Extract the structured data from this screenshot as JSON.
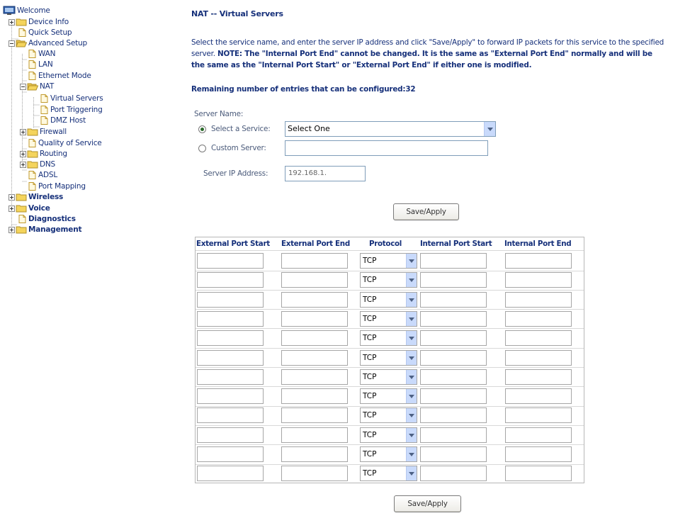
{
  "sidebar": {
    "items": [
      {
        "label": "Welcome",
        "icon": "monitor-icon",
        "bold": false
      },
      {
        "label": "Device Info",
        "icon": "folder-icon",
        "bold": false
      },
      {
        "label": "Quick Setup",
        "icon": "document-icon",
        "bold": false
      },
      {
        "label": "Advanced Setup",
        "icon": "folder-open-icon",
        "bold": false
      },
      {
        "label": "WAN",
        "icon": "document-icon",
        "bold": false
      },
      {
        "label": "LAN",
        "icon": "document-icon",
        "bold": false
      },
      {
        "label": "Ethernet Mode",
        "icon": "document-icon",
        "bold": false
      },
      {
        "label": "NAT",
        "icon": "folder-open-icon",
        "bold": false
      },
      {
        "label": "Virtual Servers",
        "icon": "document-icon",
        "bold": false
      },
      {
        "label": "Port Triggering",
        "icon": "document-icon",
        "bold": false
      },
      {
        "label": "DMZ Host",
        "icon": "document-icon",
        "bold": false
      },
      {
        "label": "Firewall",
        "icon": "folder-icon",
        "bold": false
      },
      {
        "label": "Quality of Service",
        "icon": "document-icon",
        "bold": false
      },
      {
        "label": "Routing",
        "icon": "folder-icon",
        "bold": false
      },
      {
        "label": "DNS",
        "icon": "folder-icon",
        "bold": false
      },
      {
        "label": "ADSL",
        "icon": "document-icon",
        "bold": false
      },
      {
        "label": "Port Mapping",
        "icon": "document-icon",
        "bold": false
      },
      {
        "label": "Wireless",
        "icon": "folder-icon",
        "bold": true
      },
      {
        "label": "Voice",
        "icon": "folder-icon",
        "bold": true
      },
      {
        "label": "Diagnostics",
        "icon": "document-icon",
        "bold": true
      },
      {
        "label": "Management",
        "icon": "folder-icon",
        "bold": true
      }
    ]
  },
  "main": {
    "title": "NAT -- Virtual Servers",
    "desc_plain": "Select the service name, and enter the server IP address and click \"Save/Apply\" to forward IP packets for this service to the specified server. ",
    "desc_bold": "NOTE: The \"Internal Port End\" cannot be changed. It is the same as \"External Port End\" normally and will be the same as the \"Internal Port Start\" or \"External Port End\" if either one is modified.",
    "remaining": "Remaining number of entries that can be configured:32",
    "server_name_label": "Server Name:",
    "select_service_label": "Select a Service:",
    "select_service_value": "Select One",
    "custom_server_label": "Custom Server:",
    "custom_server_value": "",
    "server_ip_label": "Server IP Address:",
    "server_ip_value": "192.168.1.",
    "save_apply_label": "Save/Apply",
    "save_apply_bottom_label": "Save/Apply"
  },
  "table": {
    "headers": [
      "External Port Start",
      "External Port End",
      "Protocol",
      "Internal Port Start",
      "Internal Port End"
    ],
    "rows": [
      {
        "protocol": "TCP"
      },
      {
        "protocol": "TCP"
      },
      {
        "protocol": "TCP"
      },
      {
        "protocol": "TCP"
      },
      {
        "protocol": "TCP"
      },
      {
        "protocol": "TCP"
      },
      {
        "protocol": "TCP"
      },
      {
        "protocol": "TCP"
      },
      {
        "protocol": "TCP"
      },
      {
        "protocol": "TCP"
      },
      {
        "protocol": "TCP"
      },
      {
        "protocol": "TCP"
      }
    ]
  },
  "colors": {
    "text_blue": "#16307a",
    "folder_yellow": "#f4d45c",
    "select_arrow_bg": "#c9dafb"
  }
}
